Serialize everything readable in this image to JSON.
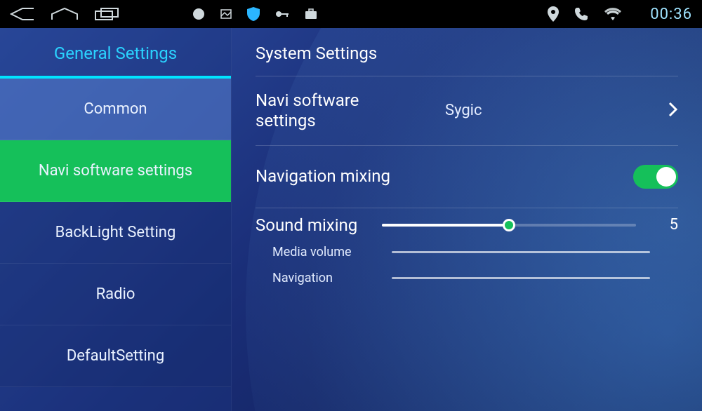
{
  "statusbar": {
    "clock": "00:36"
  },
  "sidebar": {
    "title": "General Settings",
    "items": [
      {
        "label": "Common"
      },
      {
        "label": "Navi software settings"
      },
      {
        "label": "BackLight Setting"
      },
      {
        "label": "Radio"
      },
      {
        "label": "DefaultSetting"
      }
    ]
  },
  "content": {
    "title": "System Settings",
    "navi_software": {
      "label": "Navi software settings",
      "value": "Sygic"
    },
    "nav_mixing": {
      "label": "Navigation mixing",
      "enabled": true
    },
    "sound_mixing": {
      "label": "Sound mixing",
      "value": "5",
      "percent": 50
    },
    "sub_media": {
      "label": "Media volume"
    },
    "sub_nav": {
      "label": "Navigation"
    }
  }
}
